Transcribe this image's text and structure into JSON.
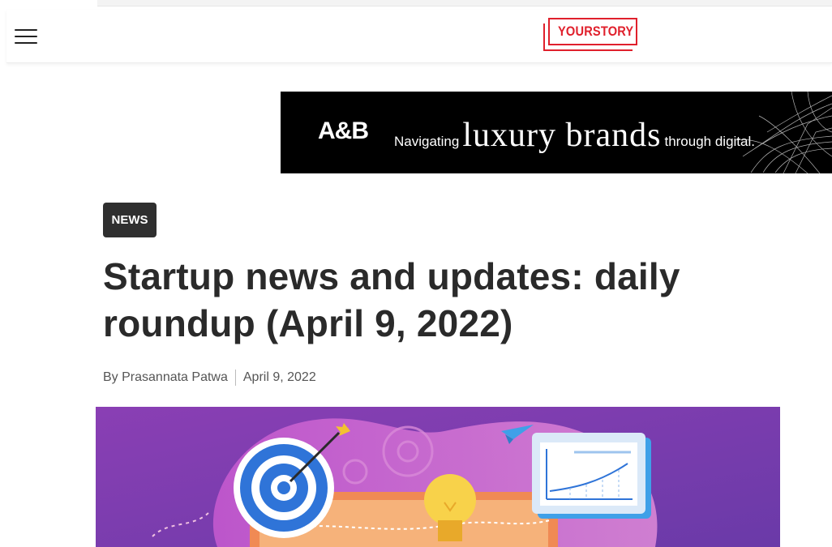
{
  "header": {
    "menu_icon": "hamburger-menu-icon",
    "logo_text": "YOURSTORY"
  },
  "ad": {
    "brand": "A&B",
    "prefix": "Navigating",
    "highlight": "luxury brands",
    "suffix": "through digital."
  },
  "article": {
    "category": "NEWS",
    "title": "Startup news and updates: daily roundup (April 9, 2022)",
    "author": "By Prasannata Patwa",
    "date": "April 9, 2022"
  },
  "colors": {
    "brand_red": "#e0202c",
    "badge_bg": "#2f2f2f",
    "hero_purple": "#7a3fb0"
  }
}
